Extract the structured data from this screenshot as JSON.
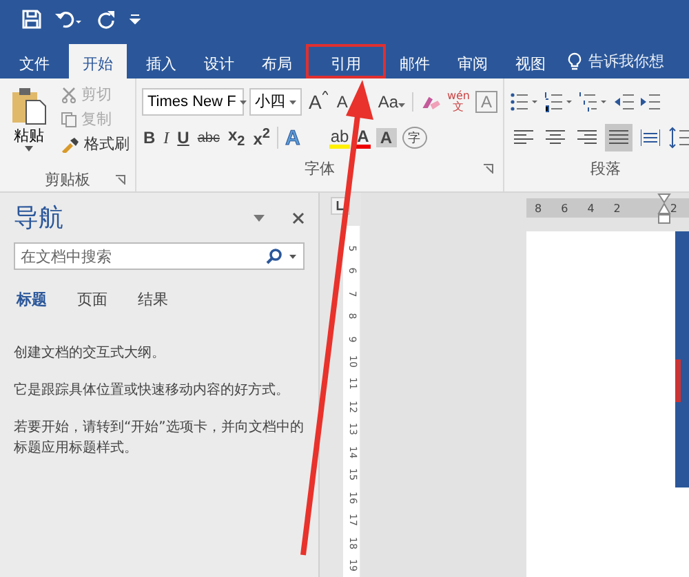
{
  "tabs": [
    {
      "label": "文件",
      "selected": false,
      "highlighted": false
    },
    {
      "label": "开始",
      "selected": true,
      "highlighted": false
    },
    {
      "label": "插入",
      "selected": false,
      "highlighted": false
    },
    {
      "label": "设计",
      "selected": false,
      "highlighted": false
    },
    {
      "label": "布局",
      "selected": false,
      "highlighted": false
    },
    {
      "label": "引用",
      "selected": false,
      "highlighted": true
    },
    {
      "label": "邮件",
      "selected": false,
      "highlighted": false
    },
    {
      "label": "审阅",
      "selected": false,
      "highlighted": false
    },
    {
      "label": "视图",
      "selected": false,
      "highlighted": false
    }
  ],
  "tell_me": "告诉我你想",
  "clipboard": {
    "paste": "粘贴",
    "tools": [
      {
        "label": "剪切",
        "kind": "cut",
        "disabled": true
      },
      {
        "label": "复制",
        "kind": "copy",
        "disabled": true
      },
      {
        "label": "格式刷",
        "kind": "painter",
        "disabled": false
      }
    ],
    "group_label": "剪贴板"
  },
  "font": {
    "name": "Times New F",
    "size": "小四",
    "group_label": "字体",
    "row1": [
      {
        "kind": "grow",
        "text": "A"
      },
      {
        "kind": "shrink",
        "text": "A"
      },
      {
        "kind": "case",
        "text": "Aa"
      },
      {
        "kind": "clear"
      },
      {
        "kind": "phonetic",
        "text": "wén",
        "sub": "文"
      },
      {
        "kind": "border",
        "text": "A"
      }
    ],
    "row2": [
      {
        "kind": "bold",
        "text": "B"
      },
      {
        "kind": "italic",
        "text": "I"
      },
      {
        "kind": "underline",
        "text": "U"
      },
      {
        "kind": "strike",
        "text": "abc"
      },
      {
        "kind": "subscript",
        "text": "x$_{2}$"
      },
      {
        "kind": "superscript",
        "text": "x$^{2}$"
      },
      {
        "kind": "effects",
        "text": "A"
      },
      {
        "kind": "highlight",
        "text": "ab"
      },
      {
        "kind": "color",
        "text": "A"
      },
      {
        "kind": "shade",
        "text": "A"
      },
      {
        "kind": "enclose",
        "text": "字"
      }
    ]
  },
  "paragraph": {
    "group_label": "段落",
    "alignments": [
      {
        "kind": "left",
        "selected": false
      },
      {
        "kind": "center",
        "selected": false
      },
      {
        "kind": "right",
        "selected": false
      },
      {
        "kind": "justify",
        "selected": true
      },
      {
        "kind": "distributed",
        "selected": false
      }
    ]
  },
  "navigation": {
    "title": "导航",
    "search": {
      "placeholder": "在文档中搜索"
    },
    "tabs": [
      {
        "label": "标题",
        "selected": true
      },
      {
        "label": "页面",
        "selected": false
      },
      {
        "label": "结果",
        "selected": false
      }
    ],
    "paragraphs": [
      "创建文档的交互式大纲。",
      "它是跟踪具体位置或快速移动内容的好方式。",
      "若要开始，请转到“开始”选项卡，并向文档中的标题应用标题样式。"
    ]
  },
  "h_ruler": [
    "8",
    "6",
    "4",
    "2",
    "2"
  ],
  "v_ruler": [
    "5",
    "6",
    "7",
    "8",
    "9",
    "10",
    "11",
    "12",
    "13",
    "14",
    "15",
    "16",
    "17",
    "18",
    "19"
  ]
}
